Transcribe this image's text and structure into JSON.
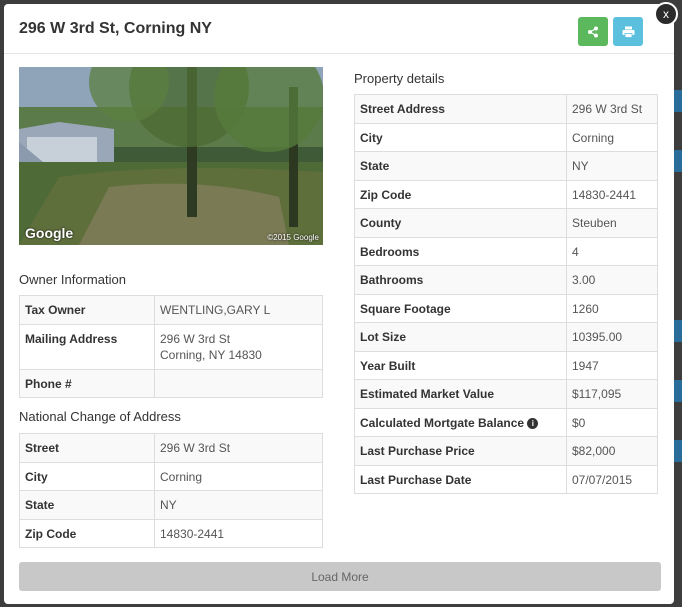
{
  "modal": {
    "title": "296 W 3rd St, Corning NY",
    "close_label": "x"
  },
  "photo": {
    "brand": "Google",
    "copyright": "©2015 Google"
  },
  "owner": {
    "title": "Owner Information",
    "rows": [
      {
        "label": "Tax Owner",
        "value": "WENTLING,GARY L"
      },
      {
        "label": "Mailing Address",
        "value": "296 W 3rd St",
        "value2": "Corning, NY 14830"
      },
      {
        "label": "Phone #",
        "value": ""
      }
    ]
  },
  "ncoa": {
    "title": "National Change of Address",
    "rows": [
      {
        "label": "Street",
        "value": "296 W 3rd St"
      },
      {
        "label": "City",
        "value": "Corning"
      },
      {
        "label": "State",
        "value": "NY"
      },
      {
        "label": "Zip Code",
        "value": "14830-2441"
      }
    ]
  },
  "property": {
    "title": "Property details",
    "rows": [
      {
        "label": "Street Address",
        "value": "296 W 3rd St"
      },
      {
        "label": "City",
        "value": "Corning"
      },
      {
        "label": "State",
        "value": "NY"
      },
      {
        "label": "Zip Code",
        "value": "14830-2441"
      },
      {
        "label": "County",
        "value": "Steuben"
      },
      {
        "label": "Bedrooms",
        "value": "4"
      },
      {
        "label": "Bathrooms",
        "value": "3.00"
      },
      {
        "label": "Square Footage",
        "value": "1260"
      },
      {
        "label": "Lot Size",
        "value": "10395.00"
      },
      {
        "label": "Year Built",
        "value": "1947"
      },
      {
        "label": "Estimated Market Value",
        "value": "$117,095"
      },
      {
        "label": "Calculated Mortgate Balance",
        "value": "$0"
      },
      {
        "label": "Last Purchase Price",
        "value": "$82,000"
      },
      {
        "label": "Last Purchase Date",
        "value": "07/07/2015"
      }
    ]
  },
  "load_more_label": "Load More",
  "colors": {
    "share": "#5cb85c",
    "print": "#5bc0de"
  }
}
